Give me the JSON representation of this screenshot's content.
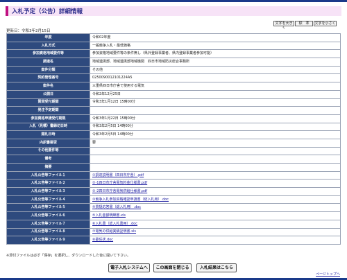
{
  "header": {
    "title": "入札予定（公告）詳細情報"
  },
  "update_date": "更新日：令和3年2月15日",
  "font_controls": {
    "large": "文字を大きく",
    "standard": "標　準",
    "small": "文字を小さく"
  },
  "rows": [
    {
      "label": "年度",
      "value": "令和02年度"
    },
    {
      "label": "入札方式",
      "value": "一般競争入札・最低価格"
    },
    {
      "label": "参加資格地域要件等",
      "value": "参加資格地域要件等の条件無し（県外登録事業者、県内登録事業者参加可能）"
    },
    {
      "label": "調達名",
      "value": "地域連携部、地域連携部地域機関　四日市地域防災総合事務所"
    },
    {
      "label": "案件分類",
      "value": "その他"
    },
    {
      "label": "契約管理番号",
      "value": "0250090012101224A5"
    },
    {
      "label": "案件名",
      "value": "三重県四日市庁舎で使用する電気"
    },
    {
      "label": "公開日",
      "value": "令和2年12月25日"
    },
    {
      "label": "質問受付期間",
      "value": "令和3年1月12日 15時00分"
    },
    {
      "label": "発注予定期間",
      "value": ""
    },
    {
      "label": "参加資格申請受付期限",
      "value": "令和3年1月22日 15時00分"
    },
    {
      "label": "入札（見積）書締切日時",
      "value": "令和3年2月5日 14時00分"
    },
    {
      "label": "開札日時",
      "value": "令和3年2月5日 14時00分"
    },
    {
      "label": "内訳書要否",
      "value": "要"
    },
    {
      "label": "その他要件等",
      "value": ""
    },
    {
      "label": "備考",
      "value": ""
    },
    {
      "label": "摘要",
      "value": ""
    },
    {
      "label": "入札公告等ファイル１",
      "value": "①調達説明書（四日市庁舎）.pdf",
      "link": true
    },
    {
      "label": "入札公告等ファイル２",
      "value": "②-1四日市庁舎電気料金仕様書.pdf",
      "link": true
    },
    {
      "label": "入札公告等ファイル３",
      "value": "②-2四日市庁舎電気供給仕様書.pdf",
      "link": true
    },
    {
      "label": "入札公告等ファイル４",
      "value": "③競争入札参加資格確認申請書（総入札用）.doc",
      "link": true
    },
    {
      "label": "入札公告等ファイル５",
      "value": "④質疑応答書（総入札用）.doc",
      "link": true
    },
    {
      "label": "入札公告等ファイル６",
      "value": "⑤入札金額明細書.xls",
      "link": true
    },
    {
      "label": "入札公告等ファイル７",
      "value": "⑥入札書（総入札書用）.doc",
      "link": true
    },
    {
      "label": "入札公告等ファイル８",
      "value": "⑦電気の供給実績証明書.xls",
      "link": true
    },
    {
      "label": "入札公告等ファイル９",
      "value": "⑧委任状.doc",
      "link": true
    }
  ],
  "footnote": "※添付ファイルは必ず「保存」を選択し、ダウンロードした後に開いて下さい。",
  "buttons": {
    "system": "電子入札システムへ",
    "close": "この画面を閉じる",
    "result": "入札結果はこちら"
  },
  "page_top": "ページトップへ"
}
